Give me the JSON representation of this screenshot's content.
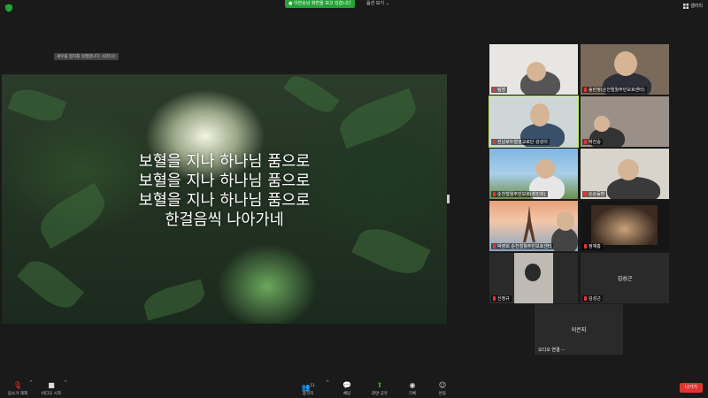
{
  "top": {
    "share_banner": "● 이한승님 화면을 보고 있습니다",
    "view_options": "옵션 보기 ⌄",
    "gallery_view": "갤러리"
  },
  "share": {
    "caption": "새우울 접지를 실행합니다. (Q터나)",
    "lyrics": [
      "보혈을 지나 하나님 품으로",
      "보혈을 지나 하나님 품으로",
      "보혈을 지나 하나님 품으로",
      "한걸음씩 나아가네"
    ]
  },
  "participants": [
    {
      "name": "팀장",
      "muted": true
    },
    {
      "name": "송란정(순천철월주민보호센터)",
      "muted": true
    },
    {
      "name": "전남로두철영교로단 강성이",
      "muted": true
    },
    {
      "name": "박진승",
      "muted": true
    },
    {
      "name": "순천철월주민보호(최민희)",
      "muted": true
    },
    {
      "name": "손순동환",
      "muted": true
    },
    {
      "name": "박영희 순천철월주민보호센터",
      "muted": true
    },
    {
      "name": "정재홍",
      "muted": true
    },
    {
      "name": "신정규",
      "muted": true
    },
    {
      "name": "김성근",
      "muted": true,
      "display": "김성근"
    },
    {
      "name": "오디오 연결 ⋯",
      "muted": false,
      "display": "이은지"
    }
  ],
  "toolbar": {
    "unmute": "음소거 해제",
    "start_video": "비디오 시작",
    "participants": "참가자",
    "participants_count": "11",
    "chat": "채팅",
    "share_screen": "화면 공유",
    "record": "기록",
    "reactions": "반응",
    "leave": "나가기"
  },
  "colors": {
    "share_green": "#23a336",
    "leave_red": "#e0352f",
    "active_speaker": "#b7e35a",
    "muted_red": "#e33333"
  }
}
